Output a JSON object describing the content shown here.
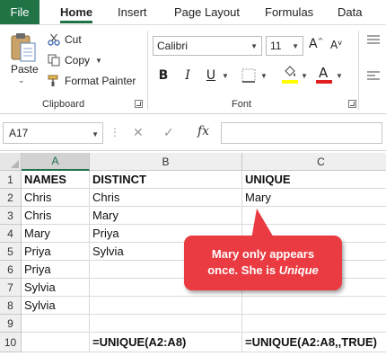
{
  "ribbon_tabs": [
    "File",
    "Home",
    "Insert",
    "Page Layout",
    "Formulas",
    "Data"
  ],
  "clipboard": {
    "paste": "Paste",
    "cut": "Cut",
    "copy": "Copy",
    "format_painter": "Format Painter",
    "group_label": "Clipboard"
  },
  "font_group": {
    "font_name": "Calibri",
    "font_size": "11",
    "bold": "B",
    "italic": "I",
    "underline": "U",
    "font_color_glyph": "A",
    "grow_glyph": "A",
    "shrink_glyph": "A",
    "group_label": "Font",
    "highlight_color": "#ffff00",
    "font_color": "#e02020"
  },
  "formula_bar": {
    "name_box": "A17",
    "fx": "fx",
    "formula": ""
  },
  "columns": [
    "A",
    "B",
    "C"
  ],
  "rows": [
    {
      "num": "1",
      "a": "NAMES",
      "b": "DISTINCT",
      "c": "UNIQUE"
    },
    {
      "num": "2",
      "a": "Chris",
      "b": "Chris",
      "c": "Mary"
    },
    {
      "num": "3",
      "a": "Chris",
      "b": "Mary",
      "c": ""
    },
    {
      "num": "4",
      "a": "Mary",
      "b": "Priya",
      "c": ""
    },
    {
      "num": "5",
      "a": "Priya",
      "b": "Sylvia",
      "c": ""
    },
    {
      "num": "6",
      "a": "Priya",
      "b": "",
      "c": ""
    },
    {
      "num": "7",
      "a": "Sylvia",
      "b": "",
      "c": ""
    },
    {
      "num": "8",
      "a": "Sylvia",
      "b": "",
      "c": ""
    },
    {
      "num": "9",
      "a": "",
      "b": "",
      "c": ""
    },
    {
      "num": "10",
      "a": "",
      "b": "=UNIQUE(A2:A8)",
      "c": "=UNIQUE(A2:A8,,TRUE)"
    }
  ],
  "callout": {
    "line1": "Mary only appears",
    "line2_prefix": "once. She is ",
    "line2_emphasis": "Unique",
    "color": "#ea3b42"
  },
  "accent_color": "#217346"
}
